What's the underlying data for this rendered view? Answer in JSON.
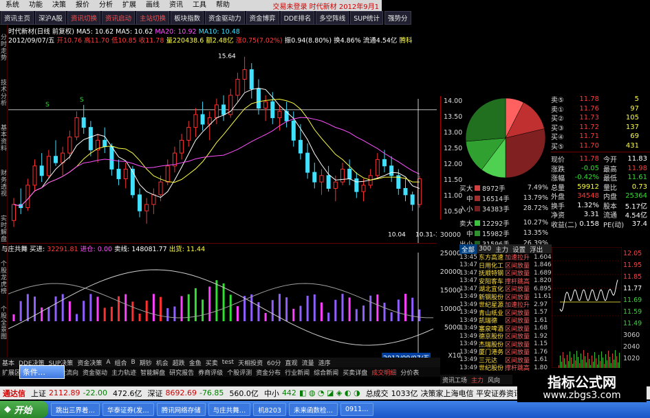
{
  "menubar": {
    "items": [
      "系统",
      "功能",
      "决策",
      "报价",
      "分析",
      "扩展",
      "画线",
      "资讯",
      "工具",
      "帮助"
    ],
    "status": "交易未登录 时代新材 2012年9月1"
  },
  "toolbar": {
    "buttons": [
      "资讯主页",
      "深沪A股",
      "资讯切换",
      "资讯启动",
      "主站切换",
      "板块指数",
      "资金驱动力",
      "资金博弈",
      "DDE排名",
      "多空阵线",
      "SUP统计",
      "强势分"
    ]
  },
  "leftnav": [
    "分时走势",
    "技术分析",
    "基本资料",
    "财务透视",
    "实时解盘",
    "个股龙虎榜",
    "个股全景图"
  ],
  "chart_header": {
    "stock": "时代新材(日线 前复权)",
    "ma5": "MA5: 10.62",
    "ma5b": "MA5: 10.62",
    "ma20": "MA20: 10.92",
    "ma10": "MA10: 10.48",
    "date": "2012/09/07/五",
    "open": "开10.76",
    "high": "高11.70",
    "low": "低10.85",
    "close": "收11.78",
    "vol": "量220438.6",
    "amt": "额2.48亿",
    "chg": "涨0.75(7.02%)",
    "amp": "振0.94(8.80%)",
    "turn": "换4.86%",
    "float": "流通4.54亿",
    "ext": "腾科"
  },
  "kline_labels": {
    "high_mark": "15.64",
    "low_mark": "10.04",
    "date_mark": "10.31-1",
    "s_marks": [
      "S",
      "S"
    ]
  },
  "price_axis": [
    "14.00",
    "13.50",
    "13.00",
    "12.50",
    "12.00",
    "11.50",
    "11.00",
    "10.50"
  ],
  "dealbar": {
    "name": "与庄共舞",
    "buy_label": "买进:",
    "buy_value": "32291.81",
    "in_label": "进仓:",
    "in_value": "0.00",
    "sell_label": "卖线:",
    "sell_value": "148081.77",
    "out_label": "出货:",
    "out_value": "11.44"
  },
  "vol_axis": [
    "30000",
    "25000",
    "20000",
    "15000",
    "10000",
    "5000"
  ],
  "vol_unit": "X10",
  "date_label": "2012/09/07/五",
  "flow": {
    "buy": [
      {
        "side": "买",
        "size": "大",
        "vol": "8972手",
        "pct": "7.49%",
        "color": "#d04040"
      },
      {
        "side": "",
        "size": "中",
        "vol": "16514手",
        "pct": "13.79%",
        "color": "#a03030"
      },
      {
        "side": "入",
        "size": "小",
        "vol": "34383手",
        "pct": "28.72%",
        "color": "#702020"
      }
    ],
    "sell": [
      {
        "side": "卖",
        "size": "大",
        "vol": "12292手",
        "pct": "10.27%",
        "color": "#40c040"
      },
      {
        "side": "",
        "size": "中",
        "vol": "15982手",
        "pct": "13.35%",
        "color": "#309030"
      },
      {
        "side": "出",
        "size": "小",
        "vol": "31596手",
        "pct": "26.39%",
        "color": "#206020"
      }
    ]
  },
  "pie_slices": [
    {
      "name": "buy-big",
      "value": 7.49,
      "color": "#ff6060"
    },
    {
      "name": "buy-mid",
      "value": 13.79,
      "color": "#c03030"
    },
    {
      "name": "buy-small",
      "value": 28.72,
      "color": "#802020"
    },
    {
      "name": "sell-big",
      "value": 10.27,
      "color": "#50d050"
    },
    {
      "name": "sell-mid",
      "value": 13.35,
      "color": "#30a030"
    },
    {
      "name": "sell-small",
      "value": 26.39,
      "color": "#207020"
    }
  ],
  "quotes": {
    "asks": [
      {
        "label": "卖⑤",
        "price": "11.78",
        "vol": "5"
      },
      {
        "label": "卖①",
        "price": "11.76",
        "vol": "97"
      },
      {
        "label": "买②",
        "price": "11.73",
        "vol": "105"
      },
      {
        "label": "买③",
        "price": "11.72",
        "vol": "137"
      },
      {
        "label": "买④",
        "price": "11.71",
        "vol": "69"
      },
      {
        "label": "买⑤",
        "price": "11.70",
        "vol": "431"
      }
    ],
    "rows": [
      {
        "l": "现价",
        "v": "11.78",
        "vc": "redt",
        "l2": "今开",
        "v2": "11.83",
        "v2c": "wht"
      },
      {
        "l": "涨跌",
        "v": "-0.05",
        "vc": "grnt",
        "l2": "最高",
        "v2": "11.98",
        "v2c": "redt"
      },
      {
        "l": "涨幅",
        "v": "-0.42%",
        "vc": "grnt",
        "l2": "最低",
        "v2": "11.61",
        "v2c": "grnt"
      },
      {
        "l": "总量",
        "v": "59912",
        "vc": "yel",
        "l2": "量比",
        "v2": "0.73",
        "v2c": "yel"
      },
      {
        "l": "外盘",
        "v": "34548",
        "vc": "redt",
        "l2": "内盘",
        "v2": "25364",
        "v2c": "grnt"
      },
      {
        "l": "换手",
        "v": "1.32%",
        "vc": "wht",
        "l2": "股本",
        "v2": "5.17亿",
        "v2c": "wht"
      },
      {
        "l": "净资",
        "v": "3.31",
        "vc": "wht",
        "l2": "流通",
        "v2": "4.54亿",
        "v2c": "wht"
      },
      {
        "l": "收益(二)",
        "v": "0.158",
        "vc": "wht",
        "l2": "PE(动)",
        "v2": "37.4",
        "v2c": "wht"
      }
    ]
  },
  "ticks": {
    "tabs": [
      "全部",
      "300",
      "主力",
      "设置",
      "浮出"
    ],
    "rows": [
      {
        "t": "13:45",
        "n": "东方高速",
        "s": "加速拉升",
        "x": "1.604"
      },
      {
        "t": "13:47",
        "n": "日用化工",
        "s": "区间放量",
        "x": "1.846"
      },
      {
        "t": "13:47",
        "n": "抚顺特钢",
        "s": "区间放量",
        "x": "1.689"
      },
      {
        "t": "13:47",
        "n": "安阳客车",
        "s": "撑杆跳高",
        "x": "1.820"
      },
      {
        "t": "13:47",
        "n": "湖北宜化",
        "s": "区间放量",
        "x": "6.895"
      },
      {
        "t": "13:49",
        "n": "新钢股份",
        "s": "区间放量",
        "x": "11.61"
      },
      {
        "t": "13:49",
        "n": "世纪星源",
        "s": "加速拉升",
        "x": "2.97"
      },
      {
        "t": "13:49",
        "n": "青山纸业",
        "s": "区间放量",
        "x": "1.57"
      },
      {
        "t": "13:49",
        "n": "凯瑞德",
        "s": "区间放量",
        "x": "1.61"
      },
      {
        "t": "13:49",
        "n": "塞泉啤酒",
        "s": "区间放量",
        "x": "1.68"
      },
      {
        "t": "13:49",
        "n": "德京股份",
        "s": "区间放量",
        "x": "1.92"
      },
      {
        "t": "13:49",
        "n": "杰瑞股份",
        "s": "区间放量",
        "x": "1.15"
      },
      {
        "t": "13:49",
        "n": "厦门港务",
        "s": "区间放量",
        "x": "1.76"
      },
      {
        "t": "13:49",
        "n": "三元达",
        "s": "区间放量",
        "x": "1.61"
      },
      {
        "t": "13:49",
        "n": "世纪股份",
        "s": "撑杆跳高",
        "x": "1.80"
      }
    ]
  },
  "mini_axis": [
    "12.05",
    "11.95",
    "11.85",
    "11.77",
    "11.69",
    "11.59",
    "11.49",
    "3060",
    "2040",
    "1020"
  ],
  "bottomtabs": [
    "基本",
    "DDE决策",
    "SUP决策",
    "资金决策",
    "A",
    "组合",
    "B",
    "期钞",
    "机会",
    "超跌",
    "金鱼",
    "买卖",
    "test",
    "天相投资",
    "60分",
    "直观",
    "流量",
    "涟序"
  ],
  "bottomtabs2": [
    "扩展区",
    "大单跟踪",
    "资金流向",
    "资金驱动",
    "主力轨迹",
    "智能解盘",
    "研究报告",
    "券商评级",
    "个股评测",
    "资金分布",
    "行业新闻",
    "综合新闻",
    "买卖详盘",
    "成交明细",
    "分价表"
  ],
  "bottomtabs2_on": 13,
  "righttabs": [
    "资讯工场",
    "主力",
    "风向"
  ],
  "index": {
    "bar": "通达信",
    "sh": "上证",
    "sh_val": "2112.89",
    "sh_chg": "-22.00",
    "sh_amt": "472.6亿",
    "sz": "深证",
    "sz_val": "8692.69",
    "sz_chg": "-76.85",
    "sz_amt": "560.0亿",
    "zx": "中小",
    "zx_val": "442",
    "total": "总成交",
    "total_val": "1033亿",
    "news": "决策家上海电信 平安证券资讯"
  },
  "taskbar": {
    "start": "开始",
    "items": [
      "跳出三界着…",
      "华泰证券(发…",
      "腾讯网络存储",
      "与庄共舞…",
      "机8203",
      "未来函数检…",
      "0911…"
    ]
  },
  "popup": "条件…",
  "watermark": {
    "line1": "指标公式网",
    "line2": "www.zbgs3.com"
  },
  "kdata": [
    [
      10.5,
      11.2,
      10.3,
      11.0
    ],
    [
      11.0,
      11.5,
      10.7,
      10.9
    ],
    [
      10.9,
      11.8,
      10.8,
      11.6
    ],
    [
      11.6,
      12.4,
      11.4,
      12.2
    ],
    [
      12.2,
      12.6,
      11.7,
      11.9
    ],
    [
      11.9,
      12.7,
      11.8,
      12.5
    ],
    [
      12.5,
      13.0,
      12.2,
      12.3
    ],
    [
      12.3,
      12.8,
      11.9,
      12.6
    ],
    [
      12.6,
      13.3,
      12.4,
      13.1
    ],
    [
      13.1,
      13.9,
      13.0,
      13.7
    ],
    [
      13.7,
      14.1,
      13.2,
      13.4
    ],
    [
      13.4,
      13.6,
      12.5,
      12.7
    ],
    [
      12.7,
      13.2,
      12.3,
      13.0
    ],
    [
      13.0,
      13.4,
      12.6,
      12.8
    ],
    [
      12.8,
      12.9,
      11.9,
      12.1
    ],
    [
      12.1,
      12.4,
      11.6,
      11.8
    ],
    [
      11.8,
      12.3,
      11.5,
      12.1
    ],
    [
      12.1,
      12.2,
      11.2,
      11.3
    ],
    [
      11.3,
      11.5,
      10.6,
      10.8
    ],
    [
      10.8,
      11.2,
      10.4,
      11.0
    ],
    [
      11.0,
      11.5,
      10.7,
      11.3
    ],
    [
      11.3,
      11.9,
      11.1,
      11.7
    ],
    [
      11.7,
      12.4,
      11.6,
      12.2
    ],
    [
      12.2,
      12.8,
      12.0,
      12.6
    ],
    [
      12.6,
      13.2,
      12.4,
      13.0
    ],
    [
      13.0,
      13.6,
      12.8,
      13.4
    ],
    [
      13.4,
      14.0,
      13.1,
      13.8
    ],
    [
      13.8,
      14.2,
      13.3,
      13.5
    ],
    [
      13.5,
      13.9,
      13.0,
      13.7
    ],
    [
      13.7,
      14.3,
      13.5,
      14.1
    ],
    [
      14.1,
      14.4,
      13.6,
      13.8
    ],
    [
      13.8,
      14.6,
      13.7,
      14.4
    ],
    [
      14.4,
      15.1,
      14.2,
      14.9
    ],
    [
      14.9,
      15.6,
      14.5,
      15.2
    ],
    [
      15.2,
      15.4,
      14.3,
      14.6
    ],
    [
      14.6,
      14.9,
      13.8,
      14.0
    ],
    [
      14.0,
      14.4,
      13.6,
      14.2
    ],
    [
      14.2,
      14.5,
      13.5,
      13.7
    ],
    [
      13.7,
      14.1,
      13.3,
      13.9
    ],
    [
      13.9,
      14.2,
      13.4,
      13.6
    ],
    [
      13.6,
      13.9,
      12.8,
      13.0
    ],
    [
      13.0,
      13.5,
      12.4,
      12.6
    ],
    [
      12.6,
      12.9,
      11.8,
      12.0
    ],
    [
      12.0,
      12.3,
      11.5,
      11.7
    ],
    [
      11.7,
      12.1,
      11.3,
      11.9
    ],
    [
      11.9,
      12.2,
      11.4,
      11.5
    ],
    [
      11.5,
      11.9,
      11.1,
      11.7
    ],
    [
      11.7,
      12.3,
      11.6,
      12.1
    ],
    [
      12.1,
      12.4,
      11.6,
      11.8
    ],
    [
      11.8,
      12.0,
      11.2,
      11.4
    ],
    [
      11.4,
      11.8,
      11.1,
      11.6
    ],
    [
      11.6,
      12.1,
      11.5,
      11.9
    ],
    [
      11.9,
      12.6,
      11.8,
      12.4
    ],
    [
      12.4,
      12.7,
      12.0,
      12.2
    ],
    [
      12.2,
      12.5,
      11.7,
      11.9
    ],
    [
      11.9,
      12.1,
      11.3,
      11.5
    ],
    [
      11.5,
      11.8,
      11.1,
      11.3
    ],
    [
      11.3,
      11.4,
      10.8,
      11.0
    ],
    [
      11.0,
      11.9,
      10.9,
      11.8
    ]
  ]
}
